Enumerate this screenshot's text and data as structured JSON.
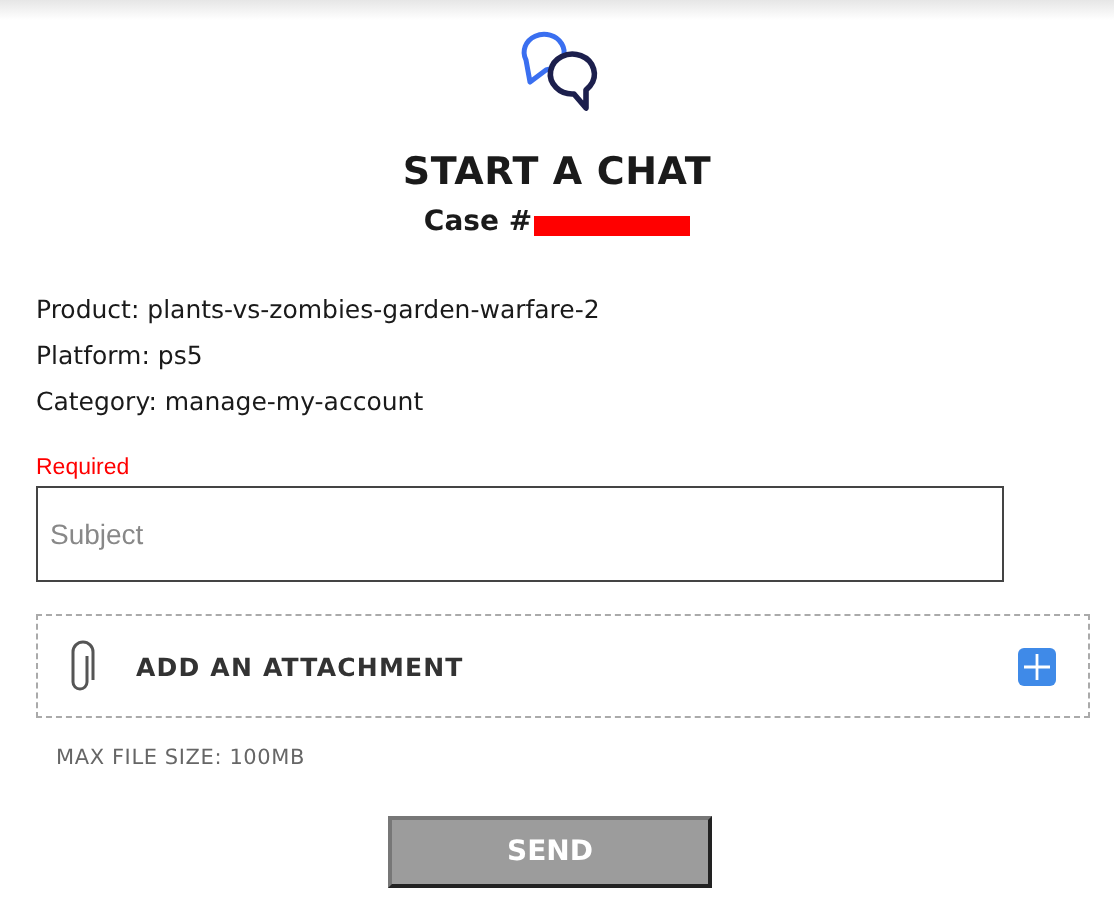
{
  "header": {
    "title": "START A CHAT",
    "case_label": "Case #"
  },
  "details": [
    {
      "label": "Product: plants-vs-zombies-garden-warfare-2"
    },
    {
      "label": "Platform: ps5"
    },
    {
      "label": "Category: manage-my-account"
    }
  ],
  "subject": {
    "required_label": "Required",
    "placeholder": "Subject"
  },
  "attachment": {
    "label": "ADD AN ATTACHMENT",
    "max_size": "MAX FILE SIZE: 100MB"
  },
  "send_button": {
    "label": "SEND",
    "disabled": true
  }
}
